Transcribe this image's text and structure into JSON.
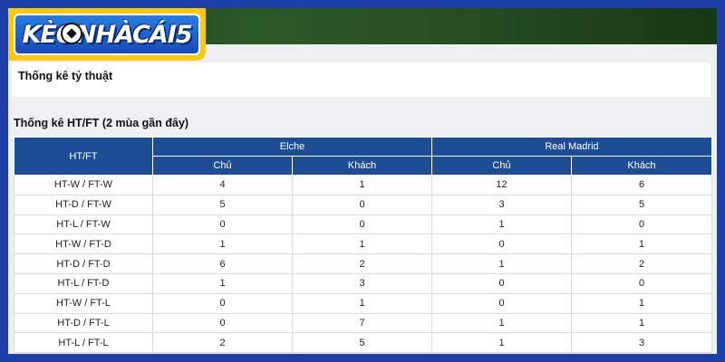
{
  "logo": {
    "text": "KÈONHÀCÁI5"
  },
  "section_odds": {
    "title": "Thống kê tỷ thuật"
  },
  "section_htft": {
    "title": "Thống kê HT/FT (2 mùa gần đây)"
  },
  "table": {
    "corner": "HT/FT",
    "teams": [
      "Elche",
      "Real Madrid"
    ],
    "sub_headers": [
      "Chủ",
      "Khách",
      "Chủ",
      "Khách"
    ],
    "rows": [
      [
        "HT-W / FT-W",
        "4",
        "1",
        "12",
        "6"
      ],
      [
        "HT-D / FT-W",
        "5",
        "0",
        "3",
        "5"
      ],
      [
        "HT-L / FT-W",
        "0",
        "0",
        "1",
        "0"
      ],
      [
        "HT-W / FT-D",
        "1",
        "1",
        "0",
        "1"
      ],
      [
        "HT-D / FT-D",
        "6",
        "2",
        "1",
        "2"
      ],
      [
        "HT-L / FT-D",
        "1",
        "3",
        "0",
        "0"
      ],
      [
        "HT-W / FT-L",
        "0",
        "1",
        "0",
        "1"
      ],
      [
        "HT-D / FT-L",
        "0",
        "7",
        "1",
        "1"
      ],
      [
        "HT-L / FT-L",
        "2",
        "5",
        "1",
        "3"
      ]
    ]
  },
  "colors": {
    "frame": "#1f3fa8",
    "header": "#1d4d94",
    "logo_bg": "#f7c913"
  }
}
